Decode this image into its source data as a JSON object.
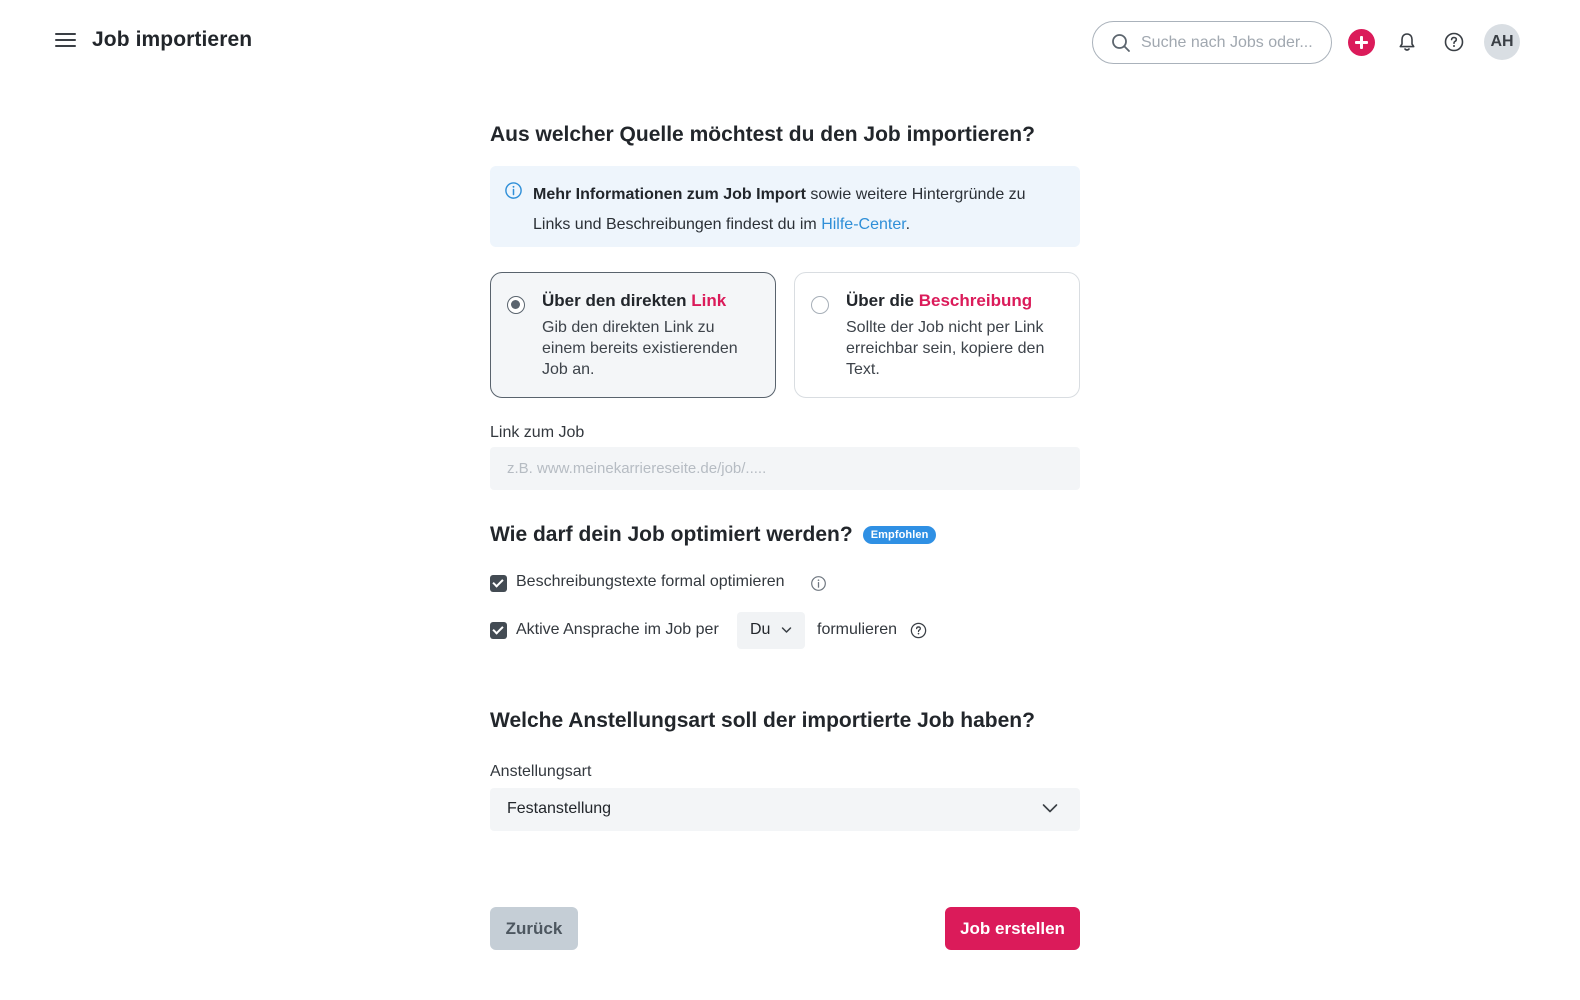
{
  "header": {
    "title": "Job importieren",
    "search_placeholder": "Suche nach Jobs oder...",
    "avatar_initials": "AH",
    "icons": [
      "menu-icon",
      "search-icon",
      "plus-icon",
      "bell-icon",
      "help-icon"
    ]
  },
  "source": {
    "heading": "Aus welcher Quelle möchtest du den Job importieren?",
    "info": {
      "bold": "Mehr Informationen zum Job Import",
      "text": " sowie weitere Hintergründe zu Links und Beschreibungen findest du im ",
      "link": "Hilfe-Center",
      "end": "."
    },
    "options": [
      {
        "title_prefix": "Über den direkten ",
        "title_accent": "Link",
        "description": "Gib den direkten Link zu einem bereits existierenden Job an.",
        "selected": true
      },
      {
        "title_prefix": "Über die ",
        "title_accent": "Beschreibung",
        "description": "Sollte der Job nicht per Link erreichbar sein, kopiere den Text.",
        "selected": false
      }
    ],
    "link_label": "Link zum Job",
    "link_placeholder": "z.B. www.meinekarriereseite.de/job/.....",
    "link_value": ""
  },
  "optimize": {
    "heading": "Wie darf dein Job optimiert werden?",
    "badge": "Empfohlen",
    "option1": {
      "label": "Beschreibungstexte formal optimieren",
      "checked": true
    },
    "option2": {
      "prefix": "Aktive Ansprache im Job per",
      "select_value": "Du",
      "suffix": "formulieren",
      "checked": true
    }
  },
  "employment": {
    "heading": "Welche Anstellungsart soll der importierte Job haben?",
    "label": "Anstellungsart",
    "value": "Festanstellung"
  },
  "actions": {
    "back": "Zurück",
    "create": "Job erstellen"
  },
  "colors": {
    "accent": "#db1b5a",
    "link": "#2f8fd8",
    "badge": "#2f90e4",
    "info_bg": "#eef5fc"
  }
}
